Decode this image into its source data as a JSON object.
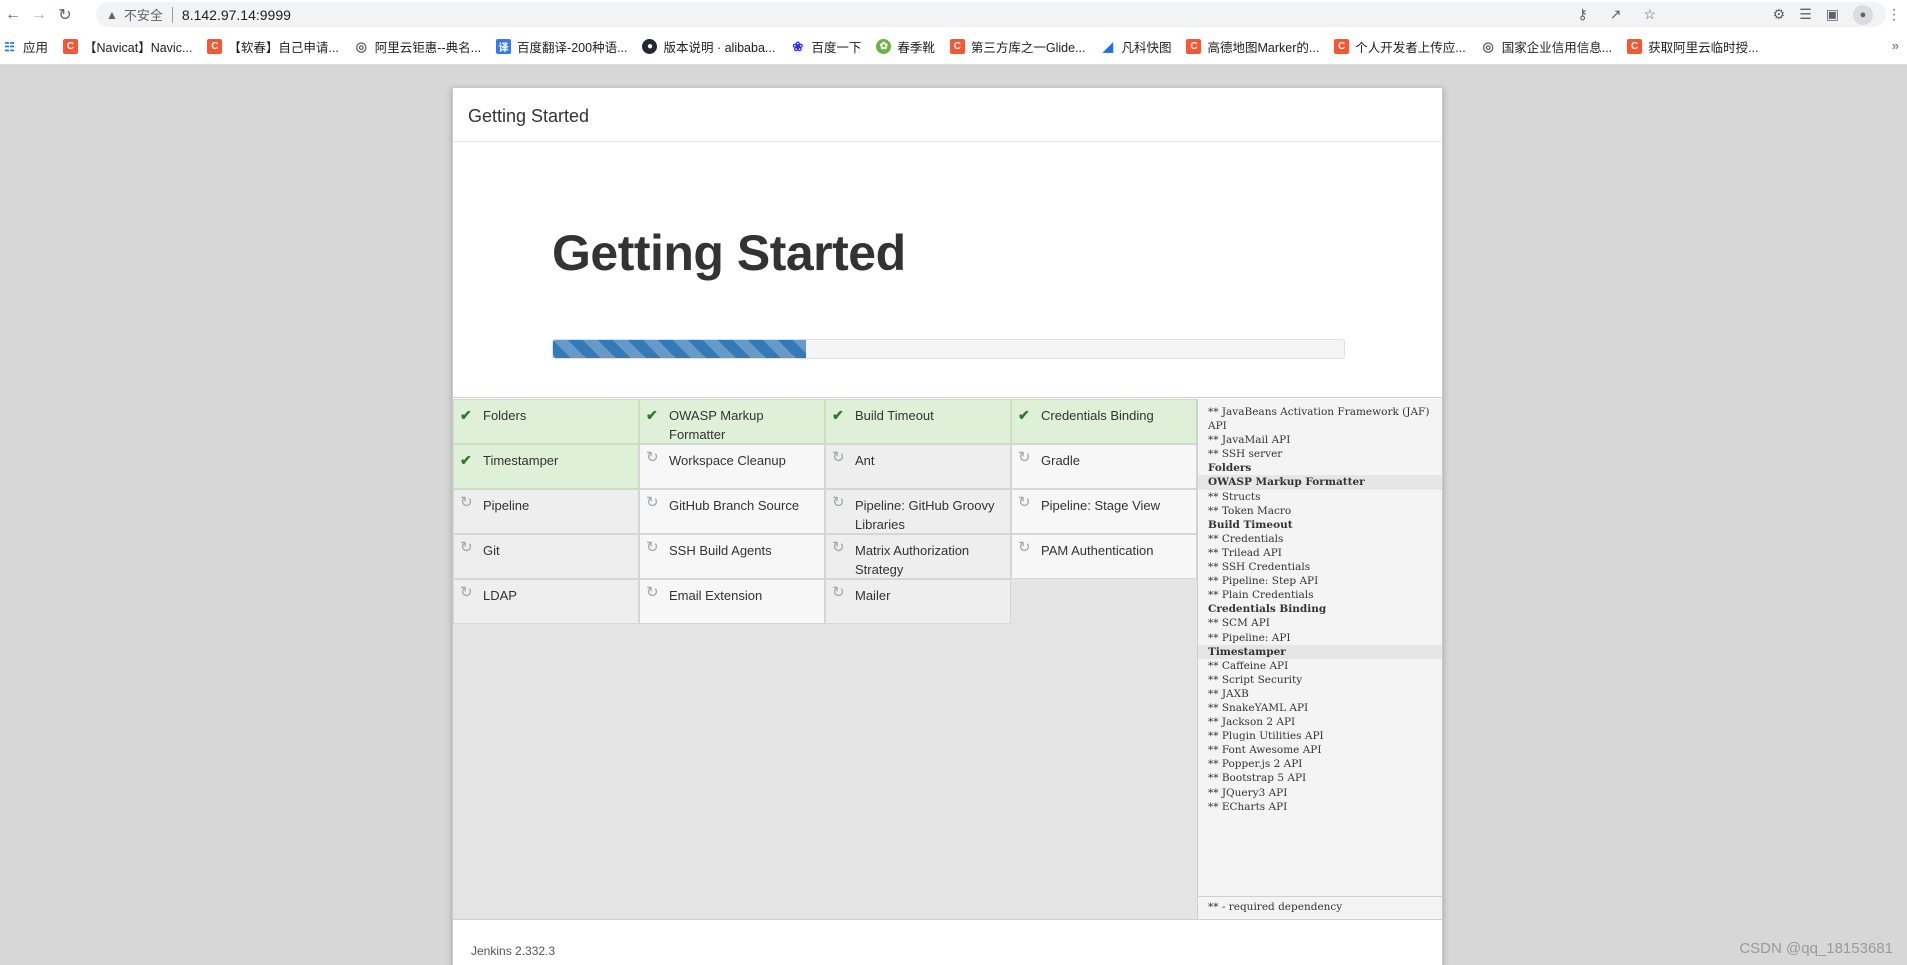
{
  "browser": {
    "insecure_label": "不安全",
    "url": "8.142.97.14:9999"
  },
  "bookmarks": [
    {
      "label": "应用",
      "icon": "apps-grid-icon"
    },
    {
      "label": "【Navicat】Navic...",
      "icon": "csdn-icon"
    },
    {
      "label": "【软春】自己申请...",
      "icon": "csdn-icon"
    },
    {
      "label": "阿里云钜惠--典名...",
      "icon": "globe-icon"
    },
    {
      "label": "百度翻译-200种语...",
      "icon": "translate-icon"
    },
    {
      "label": "版本说明 · alibaba...",
      "icon": "github-icon"
    },
    {
      "label": "百度一下",
      "icon": "baidu-icon"
    },
    {
      "label": "春季靴",
      "icon": "spring-icon"
    },
    {
      "label": "第三方库之一Glide...",
      "icon": "csdn-icon"
    },
    {
      "label": "凡科快图",
      "icon": "fanke-icon"
    },
    {
      "label": "高德地图Marker的...",
      "icon": "csdn-icon"
    },
    {
      "label": "个人开发者上传应...",
      "icon": "csdn-icon"
    },
    {
      "label": "国家企业信用信息...",
      "icon": "globe-icon"
    },
    {
      "label": "获取阿里云临时授...",
      "icon": "csdn-icon"
    }
  ],
  "dialog": {
    "header_title": "Getting Started",
    "hero_title": "Getting Started",
    "progress": 0.32,
    "footer_version": "Jenkins 2.332.3"
  },
  "plugins": [
    {
      "name": "Folders",
      "status": "done"
    },
    {
      "name": "OWASP Markup Formatter",
      "status": "done"
    },
    {
      "name": "Build Timeout",
      "status": "done"
    },
    {
      "name": "Credentials Binding",
      "status": "done"
    },
    {
      "name": "Timestamper",
      "status": "done"
    },
    {
      "name": "Workspace Cleanup",
      "status": "active"
    },
    {
      "name": "Ant",
      "status": "pending"
    },
    {
      "name": "Gradle",
      "status": "active"
    },
    {
      "name": "Pipeline",
      "status": "pending"
    },
    {
      "name": "GitHub Branch Source",
      "status": "active"
    },
    {
      "name": "Pipeline: GitHub Groovy Libraries",
      "status": "pending"
    },
    {
      "name": "Pipeline: Stage View",
      "status": "active"
    },
    {
      "name": "Git",
      "status": "pending"
    },
    {
      "name": "SSH Build Agents",
      "status": "active"
    },
    {
      "name": "Matrix Authorization Strategy",
      "status": "pending"
    },
    {
      "name": "PAM Authentication",
      "status": "active"
    },
    {
      "name": "LDAP",
      "status": "pending"
    },
    {
      "name": "Email Extension",
      "status": "active"
    },
    {
      "name": "Mailer",
      "status": "pending"
    }
  ],
  "install_log": [
    {
      "text": "** JavaBeans Activation Framework (JAF)",
      "style": ""
    },
    {
      "text": "API",
      "style": ""
    },
    {
      "text": "** JavaMail API",
      "style": ""
    },
    {
      "text": "** SSH server",
      "style": ""
    },
    {
      "text": "Folders",
      "style": "hd"
    },
    {
      "text": "OWASP Markup Formatter",
      "style": "hd hl"
    },
    {
      "text": "** Structs",
      "style": ""
    },
    {
      "text": "** Token Macro",
      "style": ""
    },
    {
      "text": "Build Timeout",
      "style": "hd"
    },
    {
      "text": "** Credentials",
      "style": ""
    },
    {
      "text": "** Trilead API",
      "style": ""
    },
    {
      "text": "** SSH Credentials",
      "style": ""
    },
    {
      "text": "** Pipeline: Step API",
      "style": ""
    },
    {
      "text": "** Plain Credentials",
      "style": ""
    },
    {
      "text": "Credentials Binding",
      "style": "hd"
    },
    {
      "text": "** SCM API",
      "style": ""
    },
    {
      "text": "** Pipeline: API",
      "style": ""
    },
    {
      "text": "Timestamper",
      "style": "hd hl"
    },
    {
      "text": "** Caffeine API",
      "style": ""
    },
    {
      "text": "** Script Security",
      "style": ""
    },
    {
      "text": "** JAXB",
      "style": ""
    },
    {
      "text": "** SnakeYAML API",
      "style": ""
    },
    {
      "text": "** Jackson 2 API",
      "style": ""
    },
    {
      "text": "** Plugin Utilities API",
      "style": ""
    },
    {
      "text": "** Font Awesome API",
      "style": ""
    },
    {
      "text": "** Popper.js 2 API",
      "style": ""
    },
    {
      "text": "** Bootstrap 5 API",
      "style": ""
    },
    {
      "text": "** JQuery3 API",
      "style": ""
    },
    {
      "text": "** ECharts API",
      "style": ""
    }
  ],
  "log_footer": "** - required dependency",
  "watermark": "CSDN @qq_18153681",
  "colors": {
    "progress": "#337ab7",
    "done_bg": "#dff0d8",
    "check": "#2d7a2d"
  }
}
